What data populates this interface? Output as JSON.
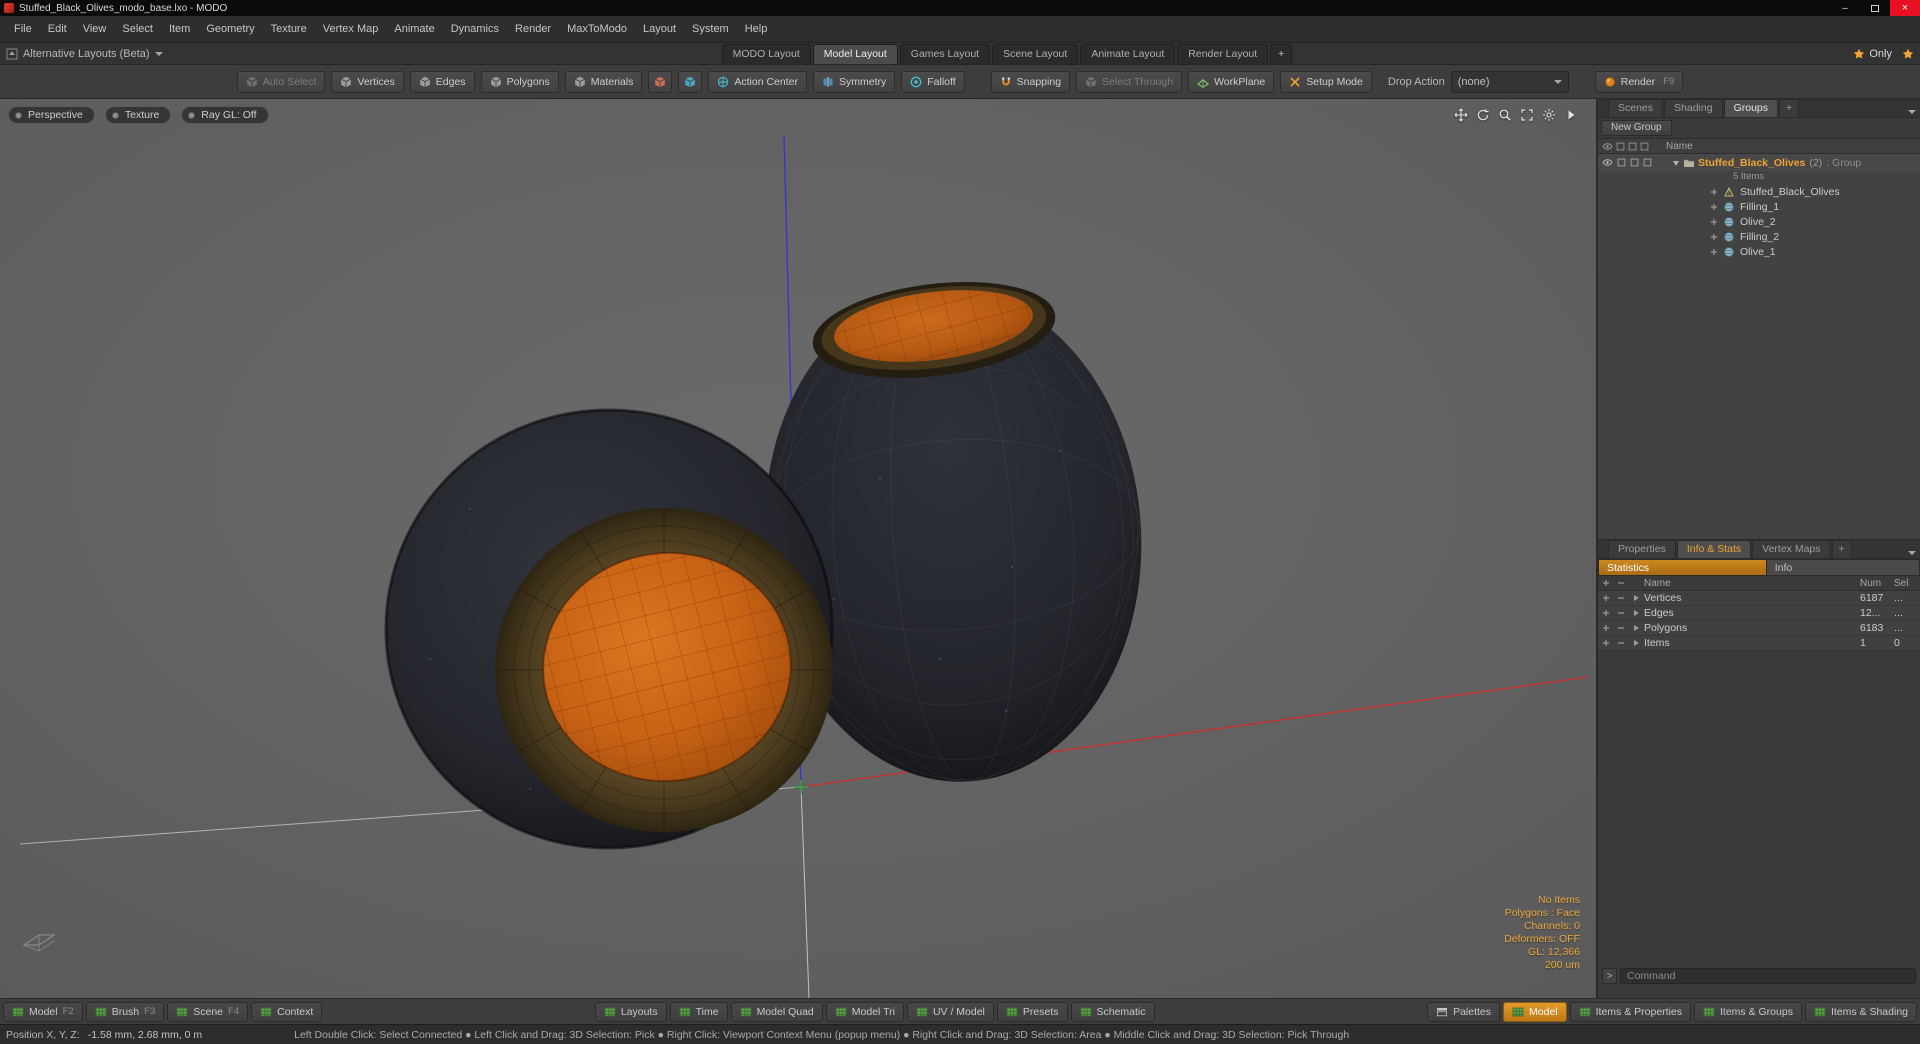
{
  "window": {
    "title": "Stuffed_Black_Olives_modo_base.lxo - MODO",
    "minimize_glyph": "–",
    "close_glyph": "×"
  },
  "menubar": {
    "items": [
      "File",
      "Edit",
      "View",
      "Select",
      "Item",
      "Geometry",
      "Texture",
      "Vertex Map",
      "Animate",
      "Dynamics",
      "Render",
      "MaxToModo",
      "Layout",
      "System",
      "Help"
    ]
  },
  "layout_bar": {
    "alt_layouts": "Alternative Layouts (Beta)",
    "tabs": [
      "MODO Layout",
      "Model Layout",
      "Games Layout",
      "Scene Layout",
      "Animate Layout",
      "Render Layout"
    ],
    "add": "+",
    "only": "Only"
  },
  "toolbar": {
    "auto_select": "Auto Select",
    "vertices": "Vertices",
    "edges": "Edges",
    "polygons": "Polygons",
    "materials": "Materials",
    "action_center": "Action Center",
    "symmetry": "Symmetry",
    "falloff": "Falloff",
    "snapping": "Snapping",
    "select_through": "Select Through",
    "workplane": "WorkPlane",
    "setup_mode": "Setup Mode",
    "drop_action_label": "Drop Action",
    "drop_action_value": "(none)",
    "render": "Render",
    "render_key": "F9"
  },
  "viewport": {
    "buttons": [
      "Perspective",
      "Texture",
      "Ray GL: Off"
    ],
    "stats": [
      "No Items",
      "Polygons : Face",
      "Channels: 0",
      "Deformers: OFF",
      "GL: 12,366",
      "200 um"
    ]
  },
  "groups_panel": {
    "tabs": [
      "Scenes",
      "Shading",
      "Groups"
    ],
    "add": "+",
    "new_group": "New Group",
    "name_header": "Name",
    "group": {
      "name": "Stuffed_Black_Olives",
      "count": "(2)",
      "suffix": ": Group",
      "items_count": "5 Items"
    },
    "items": [
      "Stuffed_Black_Olives",
      "Filling_1",
      "Olive_2",
      "Filling_2",
      "Olive_1"
    ]
  },
  "info_panel": {
    "tabs": [
      "Properties",
      "Info & Stats",
      "Vertex Maps"
    ],
    "add": "+",
    "subtabs": [
      "Statistics",
      "Info"
    ],
    "headers": {
      "name": "Name",
      "num": "Num",
      "sel": "Sel"
    },
    "rows": [
      {
        "name": "Vertices",
        "num": "6187",
        "sel": "..."
      },
      {
        "name": "Edges",
        "num": "12...",
        "sel": "..."
      },
      {
        "name": "Polygons",
        "num": "6183",
        "sel": "..."
      },
      {
        "name": "Items",
        "num": "1",
        "sel": "0"
      }
    ]
  },
  "command_line": {
    "prompt": ">",
    "placeholder": "Command"
  },
  "bottom_bar": {
    "left": [
      {
        "label": "Model",
        "key": "F2"
      },
      {
        "label": "Brush",
        "key": "F3"
      },
      {
        "label": "Scene",
        "key": "F4"
      },
      {
        "label": "Context",
        "key": ""
      }
    ],
    "center": [
      "Layouts",
      "Time",
      "Model Quad",
      "Model Tri",
      "UV / Model",
      "Presets",
      "Schematic"
    ],
    "right": [
      "Palettes",
      "Model",
      "Items & Properties",
      "Items & Groups",
      "Items & Shading"
    ]
  },
  "status_bar": {
    "position_label": "Position X, Y, Z:",
    "position_value": "-1.58 mm, 2.68 mm, 0 m",
    "help": "Left Double Click: Select Connected  ●  Left Click and Drag: 3D Selection: Pick  ●  Right Click: Viewport Context Menu (popup menu)  ●  Right Click and Drag: 3D Selection: Area  ●  Middle Click and Drag: 3D Selection: Pick Through"
  },
  "colors": {
    "accent_orange": "#f0a434",
    "axis_red": "#c83030",
    "axis_blue": "#3636d8",
    "olive_orange": "#c96315",
    "icon_green": "#5a9e4a"
  }
}
